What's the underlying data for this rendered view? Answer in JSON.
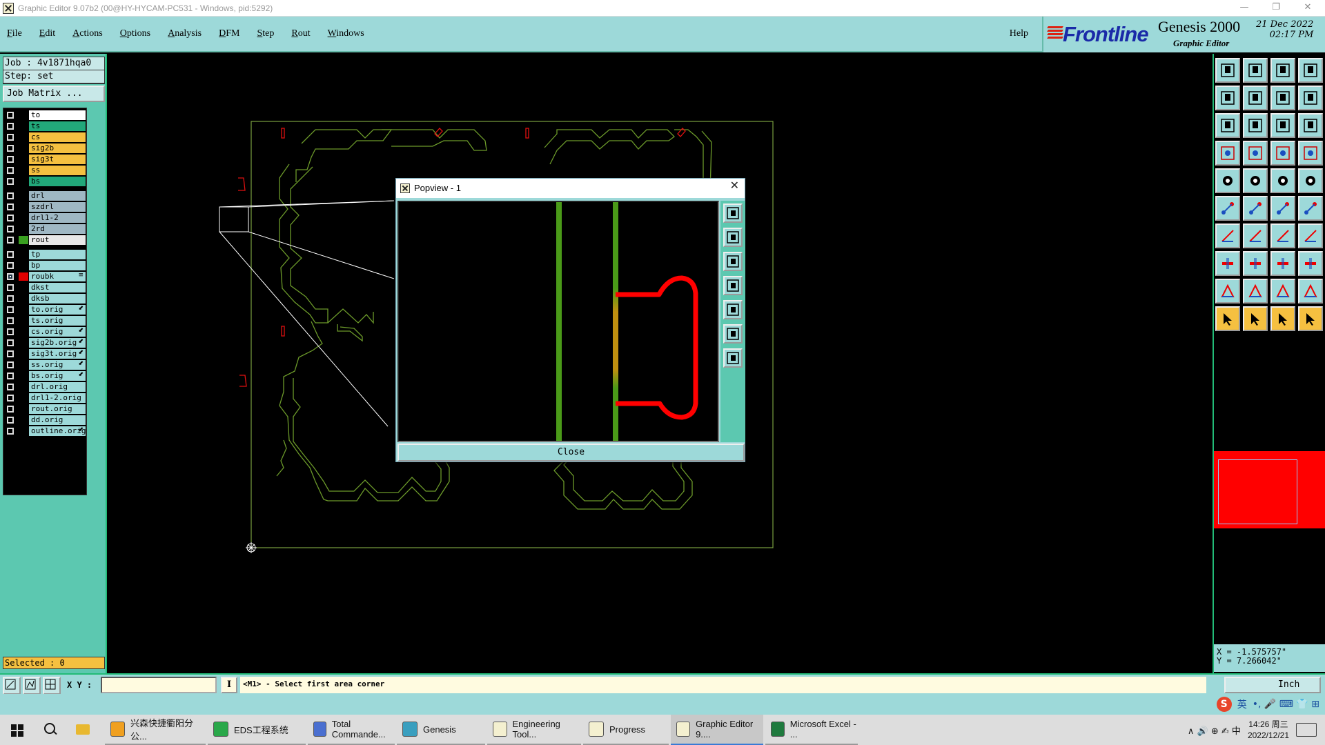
{
  "window": {
    "title": "Graphic Editor 9.07b2 (00@HY-HYCAM-PC531 - Windows, pid:5292)",
    "minimize": "—",
    "restore": "❐",
    "close": "✕"
  },
  "menu": {
    "items": [
      {
        "first": "F",
        "rest": "ile"
      },
      {
        "first": "E",
        "rest": "dit"
      },
      {
        "first": "A",
        "rest": "ctions"
      },
      {
        "first": "O",
        "rest": "ptions"
      },
      {
        "first": "A",
        "rest": "nalysis"
      },
      {
        "first": "D",
        "rest": "FM"
      },
      {
        "first": "S",
        "rest": "tep"
      },
      {
        "first": "R",
        "rest": "out"
      },
      {
        "first": "W",
        "rest": "indows"
      }
    ],
    "help": "Help"
  },
  "logo": {
    "brand": "Frontline",
    "product": "Genesis 2000",
    "subtitle": "Graphic Editor",
    "date": "21 Dec 2022",
    "time": "02:17 PM"
  },
  "job": {
    "job_line": "Job : 4v1871hqa0",
    "step_line": "Step: set",
    "matrix_button": "Job Matrix ..."
  },
  "layers": [
    {
      "name": "to",
      "color": "#ffffff",
      "swatch": "#000"
    },
    {
      "name": "ts",
      "color": "#22a87a",
      "swatch": "#000"
    },
    {
      "name": "cs",
      "color": "#f5c040",
      "swatch": "#000"
    },
    {
      "name": "sig2b",
      "color": "#f5c040",
      "swatch": "#000"
    },
    {
      "name": "sig3t",
      "color": "#f5c040",
      "swatch": "#000"
    },
    {
      "name": "ss",
      "color": "#f5c040",
      "swatch": "#000"
    },
    {
      "name": "bs",
      "color": "#22a87a",
      "swatch": "#000",
      "gap_after": true
    },
    {
      "name": "drl",
      "color": "#9fb8c4",
      "swatch": "#000"
    },
    {
      "name": "szdrl",
      "color": "#9fb8c4",
      "swatch": "#000"
    },
    {
      "name": "drl1-2",
      "color": "#9fb8c4",
      "swatch": "#000"
    },
    {
      "name": "2rd",
      "color": "#9fb8c4",
      "swatch": "#000"
    },
    {
      "name": "rout",
      "color": "#e8e8e8",
      "swatch": "#3aa020",
      "gap_after": true
    },
    {
      "name": "tp",
      "color": "#9dd9d9",
      "swatch": "#000"
    },
    {
      "name": "bp",
      "color": "#9dd9d9",
      "swatch": "#000"
    },
    {
      "name": "roubk",
      "color": "#9dd9d9",
      "swatch": "#e00000",
      "checked": true,
      "mark": "≡"
    },
    {
      "name": "dkst",
      "color": "#9dd9d9",
      "swatch": "#000"
    },
    {
      "name": "dksb",
      "color": "#9dd9d9",
      "swatch": "#000"
    },
    {
      "name": "to.orig",
      "color": "#9dd9d9",
      "swatch": "#000",
      "mark": "⬋"
    },
    {
      "name": "ts.orig",
      "color": "#9dd9d9",
      "swatch": "#000"
    },
    {
      "name": "cs.orig",
      "color": "#9dd9d9",
      "swatch": "#000",
      "mark": "⬋"
    },
    {
      "name": "sig2b.orig",
      "color": "#9dd9d9",
      "swatch": "#000",
      "mark": "⬋"
    },
    {
      "name": "sig3t.orig",
      "color": "#9dd9d9",
      "swatch": "#000",
      "mark": "⬋"
    },
    {
      "name": "ss.orig",
      "color": "#9dd9d9",
      "swatch": "#000",
      "mark": "⬋"
    },
    {
      "name": "bs.orig",
      "color": "#9dd9d9",
      "swatch": "#000",
      "mark": "⬋"
    },
    {
      "name": "drl.orig",
      "color": "#9dd9d9",
      "swatch": "#000"
    },
    {
      "name": "drl1-2.orig",
      "color": "#9dd9d9",
      "swatch": "#000"
    },
    {
      "name": "rout.orig",
      "color": "#9dd9d9",
      "swatch": "#000"
    },
    {
      "name": "dd.orig",
      "color": "#9dd9d9",
      "swatch": "#000"
    },
    {
      "name": "outline.orig",
      "color": "#9dd9d9",
      "swatch": "#000",
      "mark": "⬋"
    }
  ],
  "selected": "Selected : 0",
  "popview": {
    "title": "Popview - 1",
    "close_button": "Close",
    "close_icon": "✕"
  },
  "coords": {
    "x_line": "X = -1.575757\"",
    "y_line": "Y = 7.266042\""
  },
  "status": {
    "xy_label": "X Y :",
    "xy_value": "",
    "info_icon": "I",
    "prompt": "<M1> - Select first area corner",
    "unit": "Inch"
  },
  "ime": {
    "logo": "S",
    "lang": "英",
    "symbols": "•,  🎤  ⌨  👕  ⊞"
  },
  "taskbar": {
    "tasks": [
      {
        "label": "兴森快捷衢阳分公...",
        "icon_color": "#f0a020"
      },
      {
        "label": "EDS工程系统",
        "icon_color": "#2aa84a"
      },
      {
        "label": "Total Commande...",
        "icon_color": "#4a6fd0"
      },
      {
        "label": "Genesis",
        "icon_color": "#3a9fbf"
      },
      {
        "label": "Engineering Tool...",
        "icon_color": "#f4f0d0"
      },
      {
        "label": "Progress",
        "icon_color": "#f4f0d0"
      },
      {
        "label": "Graphic Editor 9....",
        "icon_color": "#f4f0d0",
        "active": true
      },
      {
        "label": "Microsoft Excel - ...",
        "icon_color": "#1f7a3e"
      }
    ],
    "tray_symbols": "∧  🔊  ⊕  ✍  中",
    "clock_time": "14:26 周三",
    "clock_date": "2022/12/21"
  }
}
